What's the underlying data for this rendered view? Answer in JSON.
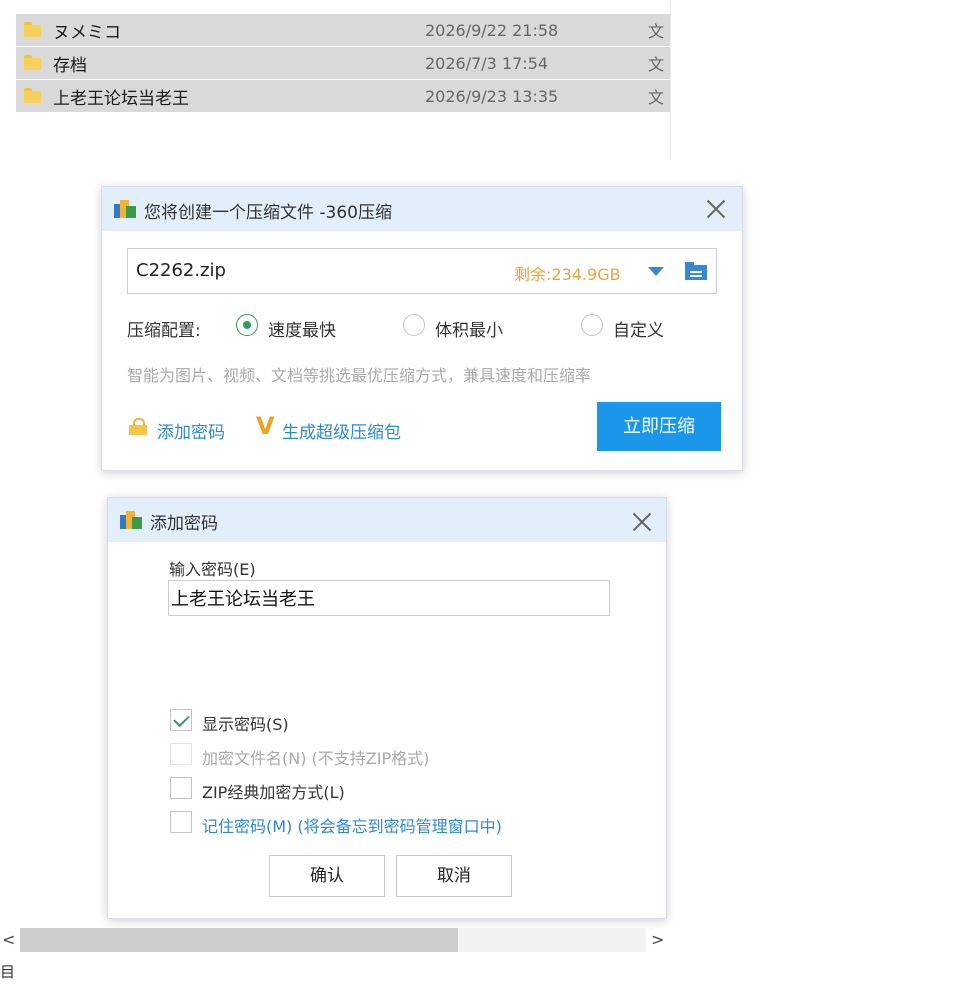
{
  "files": [
    {
      "name": "ヌメミコ",
      "date": "2026/9/22 21:58",
      "type": "文"
    },
    {
      "name": "存档",
      "date": "2026/7/3 17:54",
      "type": "文"
    },
    {
      "name": "上老王论坛当老王",
      "date": "2026/9/23 13:35",
      "type": "文"
    }
  ],
  "compress_dialog": {
    "title": "您将创建一个压缩文件 -360压缩",
    "filename": "C2262.zip",
    "free_space": "剩余:234.9GB",
    "config_label": "压缩配置:",
    "options": [
      {
        "label": "速度最快",
        "checked": true
      },
      {
        "label": "体积最小",
        "checked": false
      },
      {
        "label": "自定义",
        "checked": false
      }
    ],
    "hint": "智能为图片、视频、文档等挑选最优压缩方式，兼具速度和压缩率",
    "add_password": "添加密码",
    "super_package": "生成超级压缩包",
    "compress_now": "立即压缩"
  },
  "password_dialog": {
    "title": "添加密码",
    "input_label": "输入密码(E)",
    "password_value": "上老王论坛当老王",
    "checkboxes": [
      {
        "label": "显示密码(S)",
        "checked": true,
        "disabled": false
      },
      {
        "label": "加密文件名(N) (不支持ZIP格式)",
        "checked": false,
        "disabled": true
      },
      {
        "label": "ZIP经典加密方式(L)",
        "checked": false,
        "disabled": false
      },
      {
        "label": "记住密码(M) (将会备忘到密码管理窗口中)",
        "checked": false,
        "disabled": false
      }
    ],
    "confirm": "确认",
    "cancel": "取消"
  },
  "scrollbar": {
    "left_arrow": "<",
    "right_arrow": ">",
    "thumb_fraction": 0.7
  },
  "bottom_glyph": "目",
  "colors": {
    "accent": "#1a97ea",
    "link": "#2c8ad6",
    "space": "#f0a23a",
    "check": "#2aa05a"
  }
}
